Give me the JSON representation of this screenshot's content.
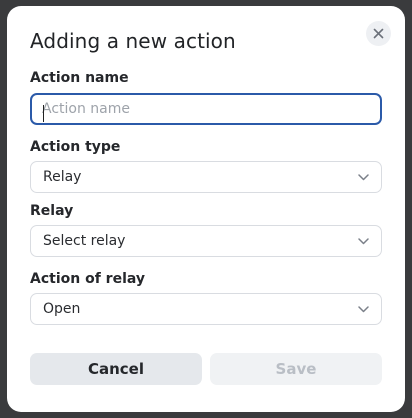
{
  "dialog": {
    "title": "Adding a new action",
    "close_icon": "close-icon"
  },
  "fields": {
    "action_name": {
      "label": "Action name",
      "value": "",
      "placeholder": "Action name"
    },
    "action_type": {
      "label": "Action type",
      "selected": "Relay"
    },
    "relay": {
      "label": "Relay",
      "selected": "Select relay"
    },
    "action_of_relay": {
      "label": "Action of relay",
      "selected": "Open"
    }
  },
  "buttons": {
    "cancel_label": "Cancel",
    "save_label": "Save",
    "save_enabled": false
  },
  "colors": {
    "focus_border": "#2b5aa9",
    "backdrop": "#3a3b3d"
  }
}
